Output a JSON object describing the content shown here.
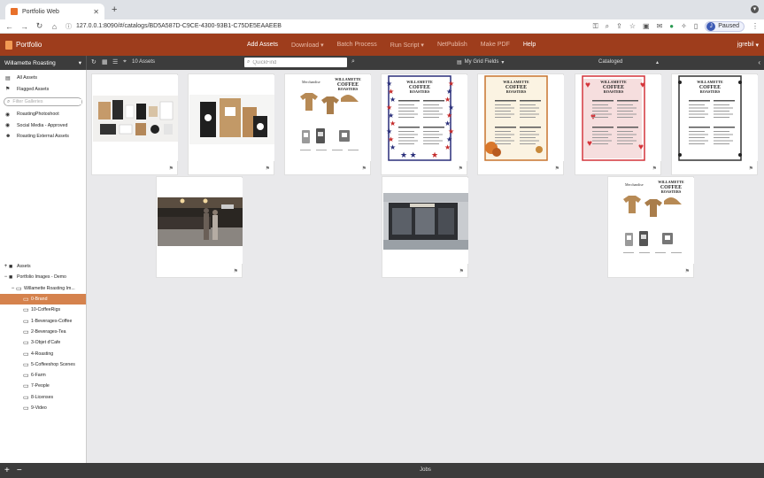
{
  "browser": {
    "tab_title": "Portfolio Web",
    "url": "127.0.0.1:8090/#/catalogs/BD5A587D-C9CE-4300-93B1-C75DE5EAAEEB",
    "profile_initial": "J",
    "profile_status": "Paused"
  },
  "app": {
    "brand": "Portfolio",
    "menu": [
      "Add Assets",
      "Download",
      "Batch Process",
      "Run Script",
      "NetPublish",
      "Make PDF",
      "Help"
    ],
    "user": "jgrebil",
    "colors": {
      "header": "#9e3d1c",
      "selected_folder": "#d5824d",
      "toolbar": "#3c3c3c"
    }
  },
  "toolbar": {
    "catalog": "Willamette Roasting",
    "asset_count": "10 Assets",
    "quickfind_placeholder": "QuickFind",
    "grid_fields": "My Grid Fields",
    "sort_by": "Cataloged"
  },
  "sidebar": {
    "nav": [
      {
        "label": "All Assets",
        "icon": "stack-icon"
      },
      {
        "label": "Flagged Assets",
        "icon": "flag-icon"
      }
    ],
    "filter_placeholder": "Filter Galleries",
    "galleries": [
      {
        "label": "RoastingPhotoshoot",
        "icon": "eye-icon"
      },
      {
        "label": "Social Media - Approved",
        "icon": "eye-icon"
      },
      {
        "label": "Roasting External Assets",
        "icon": "person-icon"
      }
    ],
    "tree": [
      {
        "label": "Assets",
        "indent": 0,
        "toggle": "+"
      },
      {
        "label": "Portfolio Images - Demo",
        "indent": 0,
        "toggle": "−"
      },
      {
        "label": "Willamette Roasting Im...",
        "indent": 1,
        "toggle": "−"
      },
      {
        "label": "0-Brand",
        "indent": 2,
        "toggle": "",
        "selected": true
      },
      {
        "label": "10-CoffeeRigs",
        "indent": 2,
        "toggle": ""
      },
      {
        "label": "1-Beverages-Coffee",
        "indent": 2,
        "toggle": ""
      },
      {
        "label": "2-Beverages-Tea",
        "indent": 2,
        "toggle": ""
      },
      {
        "label": "3-Objet d'Cafe",
        "indent": 2,
        "toggle": ""
      },
      {
        "label": "4-Roasting",
        "indent": 2,
        "toggle": ""
      },
      {
        "label": "5-Coffeeshop Scenes",
        "indent": 2,
        "toggle": ""
      },
      {
        "label": "6-Farm",
        "indent": 2,
        "toggle": ""
      },
      {
        "label": "7-People",
        "indent": 2,
        "toggle": ""
      },
      {
        "label": "8-Licenses",
        "indent": 2,
        "toggle": ""
      },
      {
        "label": "9-Video",
        "indent": 2,
        "toggle": ""
      }
    ],
    "bottom_add": "+",
    "bottom_remove": "−"
  },
  "assets": [
    {
      "kind": "brand-mockup"
    },
    {
      "kind": "bags-mockup"
    },
    {
      "kind": "merch-sheet",
      "heading": "Merchandise",
      "logo": "WILLAMETTE COFFEE ROASTERS"
    },
    {
      "kind": "menu-stars",
      "logo": "WILLAMETTE COFFEE ROASTERS",
      "frame": "#2a2f7a"
    },
    {
      "kind": "menu-leaves",
      "logo": "WILLAMETTE COFFEE ROASTERS",
      "frame": "#c8742f"
    },
    {
      "kind": "menu-hearts",
      "logo": "WILLAMETTE COFFEE ROASTERS",
      "frame": "#d4343a"
    },
    {
      "kind": "menu-snow",
      "logo": "WILLAMETTE COFFEE ROASTERS",
      "frame": "#333333"
    },
    {
      "kind": "cafe-interior"
    },
    {
      "kind": "cafe-exterior"
    },
    {
      "kind": "merch-sheet",
      "heading": "Merchandise",
      "logo": "WILLAMETTE COFFEE ROASTERS"
    }
  ],
  "jobs_label": "Jobs"
}
